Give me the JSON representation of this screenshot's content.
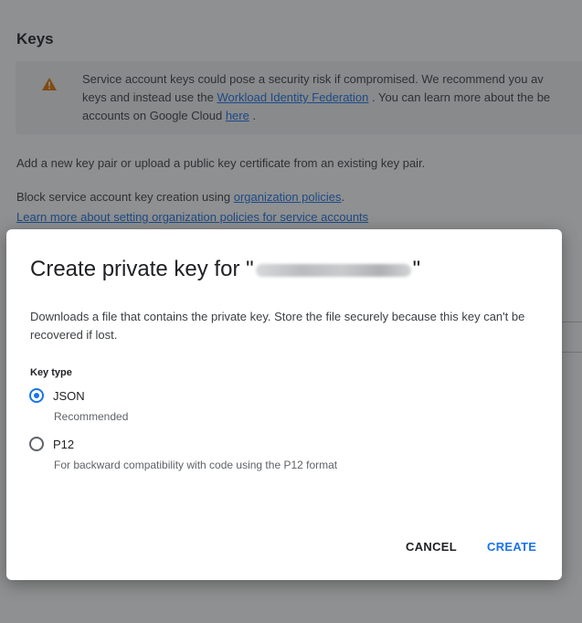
{
  "page": {
    "title": "Keys",
    "warning": {
      "icon": "warning-icon",
      "line1": "Service account keys could pose a security risk if compromised. We recommend you av",
      "line2_prefix": "keys and instead use the ",
      "line2_link": "Workload Identity Federation",
      "line2_suffix": " . You can learn more about the be",
      "line3_prefix": "accounts on Google Cloud ",
      "line3_link": "here",
      "line3_suffix": " ."
    },
    "add_key_text": "Add a new key pair or upload a public key certificate from an existing key pair.",
    "block_prefix": "Block service account key creation using ",
    "block_link": "organization policies",
    "block_suffix": ".",
    "learn_more_link": "Learn more about setting organization policies for service accounts"
  },
  "dialog": {
    "title_prefix": "Create private key for \"",
    "title_suffix": "\"",
    "description": "Downloads a file that contains the private key. Store the file securely because this key can't be recovered if lost.",
    "key_type_label": "Key type",
    "options": [
      {
        "label": "JSON",
        "help": "Recommended",
        "checked": true
      },
      {
        "label": "P12",
        "help": "For backward compatibility with code using the P12 format",
        "checked": false
      }
    ],
    "cancel_label": "CANCEL",
    "create_label": "CREATE"
  },
  "colors": {
    "accent": "#1a73e8",
    "warning": "#e37400",
    "scrim": "rgba(32,33,36,0.5)"
  }
}
